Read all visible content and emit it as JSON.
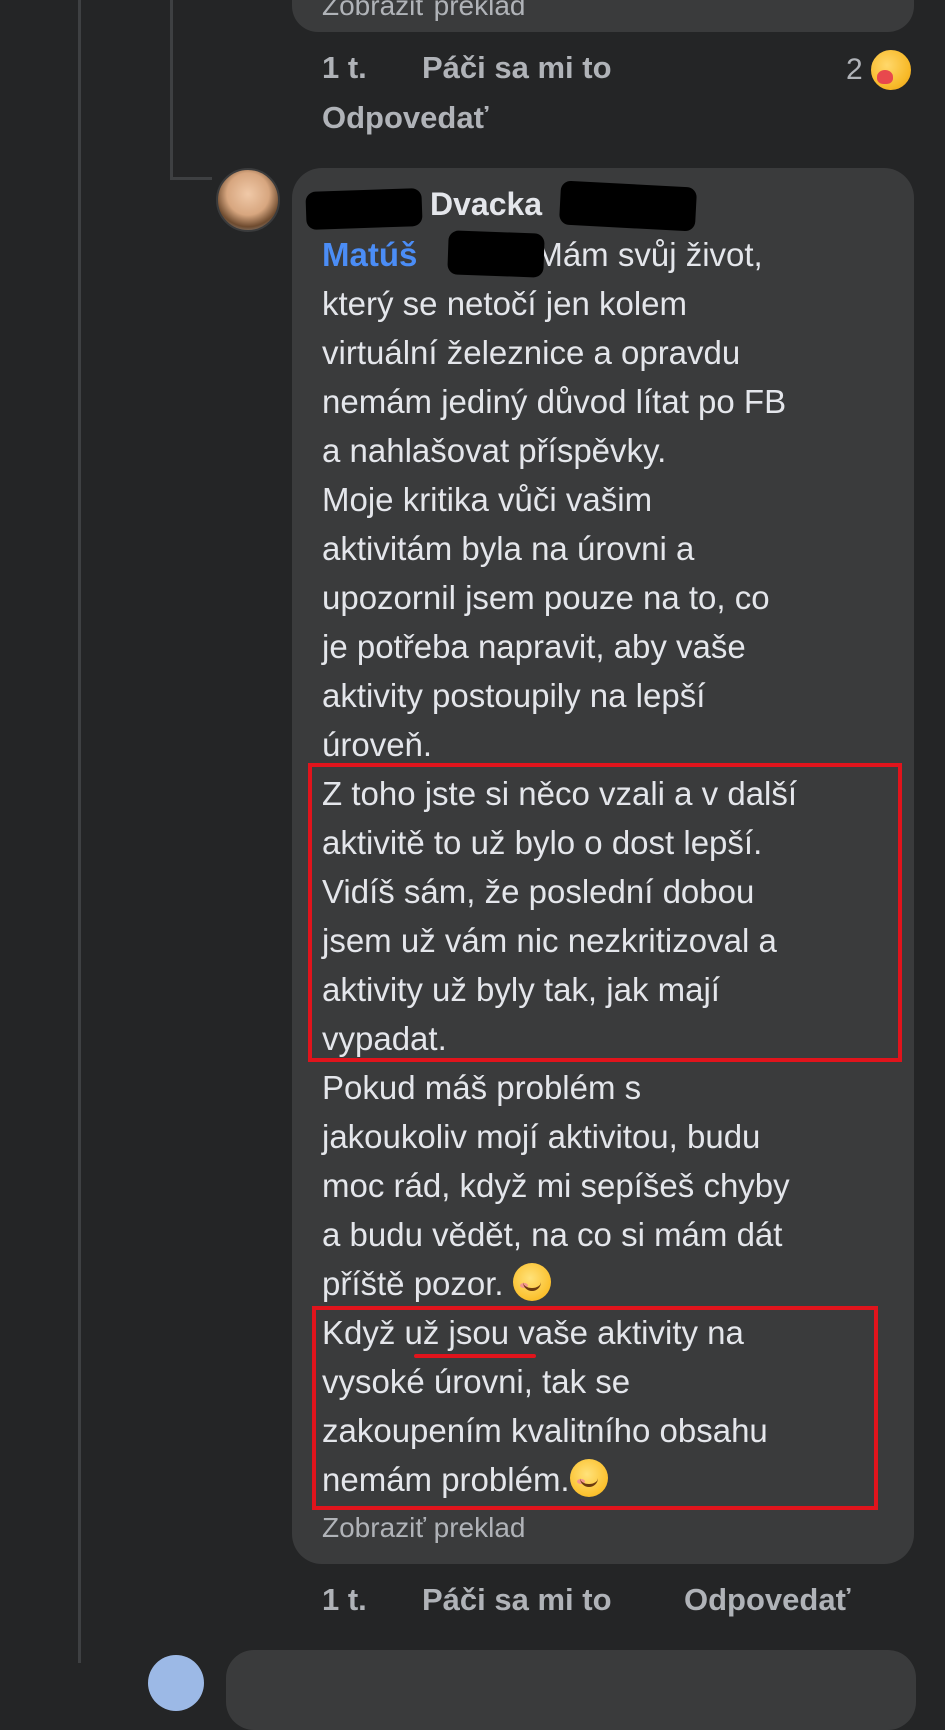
{
  "previous_comment": {
    "translate_label": "Zobraziť preklad",
    "time": "1 t.",
    "like_label": "Páči sa mi to",
    "reply_label": "Odpovedať",
    "reaction_count": "2",
    "reaction_icon": "care-reaction-icon"
  },
  "comment": {
    "author": "Dvacka",
    "mention": "Matúš",
    "lines": [
      "Mám svůj život,",
      "který se netočí jen kolem",
      "virtuální železnice a opravdu",
      "nemám jediný důvod lítat po FB",
      "a nahlašovat příspěvky.",
      "Moje kritika vůči vašim",
      "aktivitám byla na úrovni a",
      "upozornil jsem pouze na to, co",
      "je potřeba napravit, aby vaše",
      "aktivity postoupily na lepší",
      "úroveň.",
      "Z toho jste si něco vzali a v další",
      "aktivitě to už bylo o dost lepší.",
      "Vidíš sám, že poslední dobou",
      "jsem už vám nic nezkritizoval a",
      "aktivity už byly tak, jak mají",
      "vypadat.",
      "Pokud máš problém s",
      "jakoukoliv mojí aktivitou, budu",
      "moc rád, když mi sepíšeš chyby",
      "a budu vědět, na co si mám dát",
      "příště pozor.",
      "Když už jsou vaše aktivity na",
      "vysoké úrovni, tak se",
      "zakoupením kvalitního obsahu",
      "nemám problém."
    ],
    "translate_label": "Zobraziť preklad",
    "time": "1 t.",
    "like_label": "Páči sa mi to",
    "reply_label": "Odpovedať"
  },
  "annotation_color": "#e0141c",
  "mention_color": "#4b8df6"
}
